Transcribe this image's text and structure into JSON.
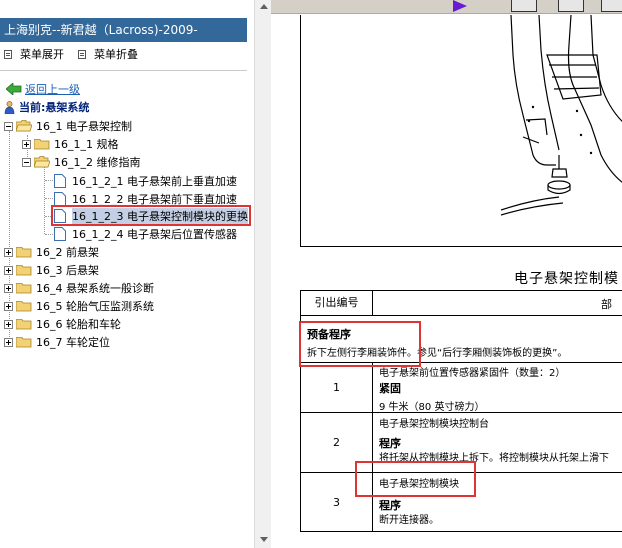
{
  "left_pane": {
    "title": "上海别克--新君越（Lacross)-2009-",
    "menu": {
      "expand_label": "菜单展开",
      "collapse_label": "菜单折叠"
    },
    "back_link": "返回上一级",
    "current_label": "当前:悬架系统",
    "tree": [
      {
        "label": "16_1 电子悬架控制",
        "level": 0,
        "state": "expanded"
      },
      {
        "label": "16_1_1 规格",
        "level": 1,
        "state": "collapsed"
      },
      {
        "label": "16_1_2 维修指南",
        "level": 1,
        "state": "expanded"
      },
      {
        "label": "16_1_2_1 电子悬架前上垂直加速",
        "level": 2,
        "type": "doc"
      },
      {
        "label": "16_1_2_2 电子悬架前下垂直加速",
        "level": 2,
        "type": "doc"
      },
      {
        "label": "16_1_2_3 电子悬架控制模块的更换",
        "level": 2,
        "type": "doc",
        "selected": true
      },
      {
        "label": "16_1_2_4 电子悬架后位置传感器",
        "level": 2,
        "type": "doc"
      },
      {
        "label": "16_2 前悬架",
        "level": 0,
        "state": "collapsed"
      },
      {
        "label": "16_3 后悬架",
        "level": 0,
        "state": "collapsed"
      },
      {
        "label": "16_4 悬架系统一般诊断",
        "level": 0,
        "state": "collapsed"
      },
      {
        "label": "16_5 轮胎气压监测系统",
        "level": 0,
        "state": "collapsed"
      },
      {
        "label": "16_6 轮胎和车轮",
        "level": 0,
        "state": "collapsed"
      },
      {
        "label": "16_7 车轮定位",
        "level": 0,
        "state": "collapsed"
      }
    ]
  },
  "document": {
    "diagram_title": "电子悬架控制模",
    "table": {
      "headers": [
        "引出编号",
        "部"
      ],
      "preparation": {
        "heading": "预备程序",
        "text": "拆下左侧行李厢装饰件。参见“后行李厢侧装饰板的更换”。"
      },
      "rows": [
        {
          "num": "1",
          "lines": [
            "电子悬架前位置传感器紧固件（数量：2）",
            "紧固",
            "9 牛米（80 英寸磅力）"
          ]
        },
        {
          "num": "2",
          "lines": [
            "电子悬架控制模块控制台",
            "程序",
            "将托架从控制模块上拆下。将控制模块从托架上滑下"
          ]
        },
        {
          "num": "3",
          "lines": [
            "电子悬架控制模块",
            "程序",
            "断开连接器。"
          ]
        }
      ]
    }
  },
  "colors": {
    "title_bar": "#33689a",
    "highlight": "#e03434",
    "link": "#1a5fb4"
  }
}
